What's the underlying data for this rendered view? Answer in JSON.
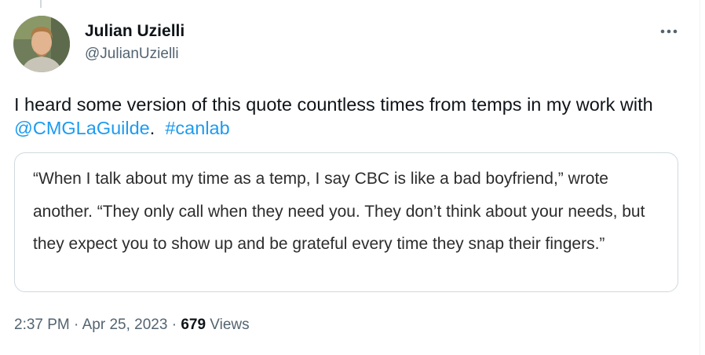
{
  "author": {
    "display_name": "Julian Uzielli",
    "handle": "@JulianUzielli"
  },
  "icons": {
    "more": "more-horizontal-icon",
    "avatar": "profile-photo"
  },
  "tweet": {
    "text_intro": "I heard some version of this quote countless times from temps in my work with ",
    "mention": "@CMGLaGuilde",
    "text_mid": ".  ",
    "hashtag": "#canlab"
  },
  "quote_image": {
    "text": "“When I talk about my time as a temp, I say CBC is like a bad boyfriend,” wrote another. “They only call when they need you. They don’t think about your needs, but they expect you to show up and be grateful every time they snap their fingers.”"
  },
  "meta": {
    "time": "2:37 PM",
    "separator": " · ",
    "date": "Apr 25, 2023",
    "views_count": "679",
    "views_label": " Views"
  },
  "colors": {
    "link": "#1d9bf0",
    "secondary_text": "#536471",
    "primary_text": "#0f1419",
    "border": "#cfd9de"
  }
}
